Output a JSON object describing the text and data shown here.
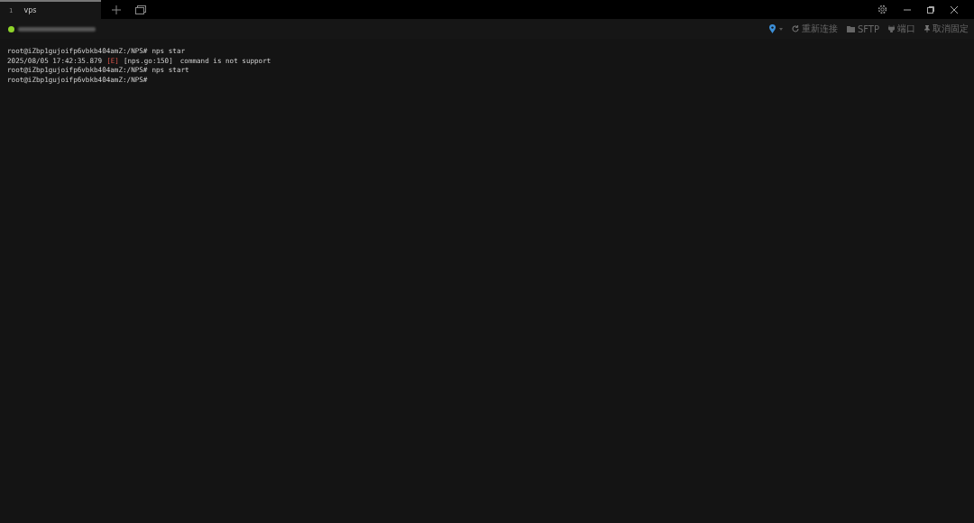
{
  "tabs": [
    {
      "index": "1",
      "label": "vps",
      "selected": true
    }
  ],
  "session": {
    "connected": true
  },
  "toolbar": [
    {
      "kind": "location"
    },
    {
      "kind": "reconnect",
      "label": "重新连接"
    },
    {
      "kind": "folder",
      "label": "SFTP"
    },
    {
      "kind": "port",
      "label": "端口"
    },
    {
      "kind": "pin",
      "label": "取消固定"
    }
  ],
  "terminal": {
    "lines": [
      {
        "kind": "prompt",
        "prompt": "root@iZbp1gujoifp6vbkb404amZ:/NPS#",
        "command": "nps star"
      },
      {
        "kind": "log",
        "time": "2025/08/05 17:42:35.879",
        "level": "[E]",
        "source": "[nps.go:150]",
        "message": "command is not support"
      },
      {
        "kind": "prompt",
        "prompt": "root@iZbp1gujoifp6vbkb404amZ:/NPS#",
        "command": "nps start"
      },
      {
        "kind": "prompt",
        "prompt": "root@iZbp1gujoifp6vbkb404amZ:/NPS#"
      }
    ]
  }
}
